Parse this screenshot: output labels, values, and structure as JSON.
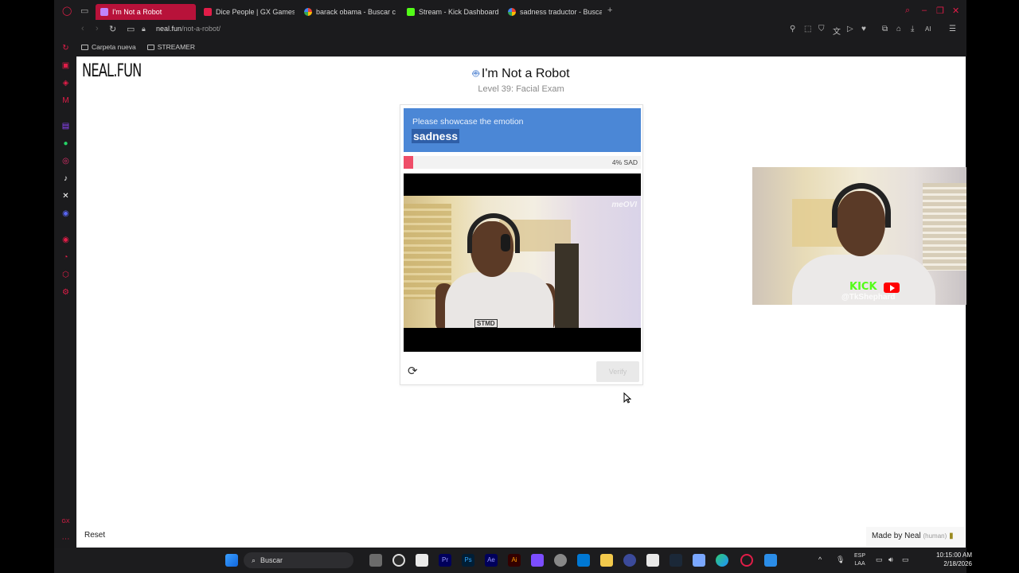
{
  "browser": {
    "tabs": [
      {
        "label": "I'm Not a Robot",
        "active": true
      },
      {
        "label": "Dice People | GX Games",
        "active": false
      },
      {
        "label": "barack obama - Buscar c",
        "active": false
      },
      {
        "label": "Stream - Kick Dashboard",
        "active": false
      },
      {
        "label": "sadness traductor - Busca",
        "active": false
      }
    ],
    "new_tab": "+",
    "url_host": "neal.fun",
    "url_path": "/not-a-robot/",
    "bookmarks": [
      "Carpeta nueva",
      "STREAMER"
    ],
    "ai_label": "AI"
  },
  "page": {
    "logo": "NEAL.FUN",
    "title": "I'm Not a Robot",
    "subtitle": "Level 39: Facial Exam",
    "prompt_line": "Please showcase the emotion",
    "emotion": "sadness",
    "meter_label": "4% SAD",
    "meter_percent": 4,
    "video_watermark": "meOVI",
    "shirt_text": "STMD",
    "verify_label": "Verify",
    "reset_label": "Reset",
    "made_by": "Made by Neal",
    "made_by_note": "(human)"
  },
  "webcam": {
    "kick_label": "KICK",
    "handle": "@TkShephard"
  },
  "taskbar": {
    "search_placeholder": "Buscar",
    "lang_top": "ESP",
    "lang_bottom": "LAA",
    "time": "10:15:00 AM",
    "date": "2/18/2026"
  },
  "colors": {
    "accent": "#b8123a",
    "prompt_blue": "#4b87d6",
    "meter_red": "#ef4d68",
    "kick_green": "#53fc18"
  }
}
